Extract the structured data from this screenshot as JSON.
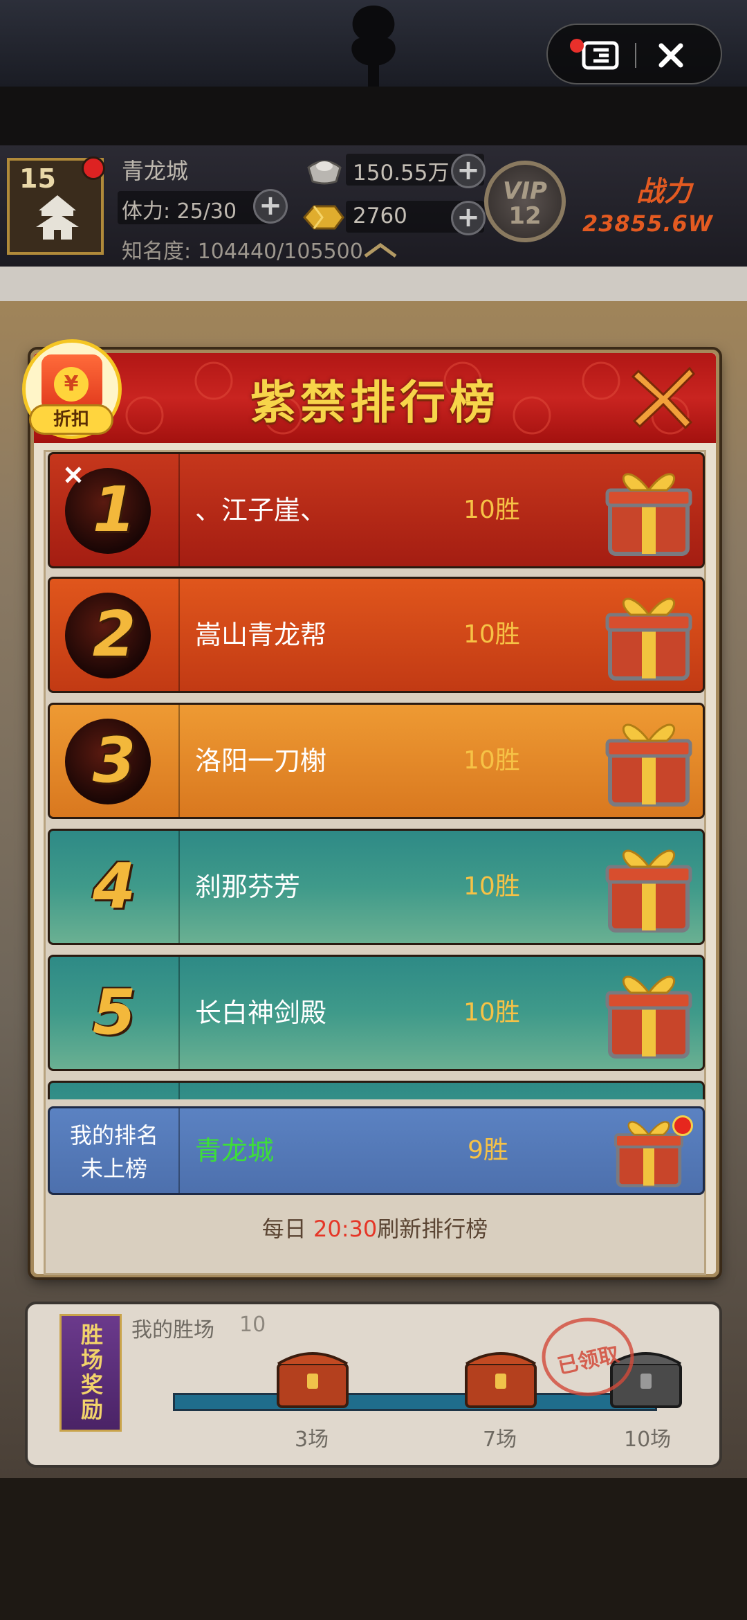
{
  "status": {
    "level": "15",
    "city_name": "青龙城",
    "stamina": "体力: 25/30",
    "fame": "知名度: 104440/105500",
    "silver": "150.55万",
    "gold": "2760",
    "vip_label": "VIP",
    "vip_level": "12",
    "power_label": "战力",
    "power_value": "23855.6W"
  },
  "discount": {
    "label": "折扣",
    "coin": "¥"
  },
  "modal": {
    "title": "紫禁排行榜",
    "rows": [
      {
        "rank": "1",
        "name": "、江子崖、",
        "wins": "10胜"
      },
      {
        "rank": "2",
        "name": "嵩山青龙帮",
        "wins": "10胜"
      },
      {
        "rank": "3",
        "name": "洛阳一刀榭",
        "wins": "10胜"
      },
      {
        "rank": "4",
        "name": "刹那芬芳",
        "wins": "10胜"
      },
      {
        "rank": "5",
        "name": "长白神剑殿",
        "wins": "10胜"
      }
    ],
    "my": {
      "label1": "我的排名",
      "label2": "未上榜",
      "name": "青龙城",
      "wins": "9胜"
    },
    "refresh": {
      "prefix": "每日 ",
      "time": "20:30",
      "suffix": "刷新排行榜"
    }
  },
  "win_panel": {
    "vlabel": "胜场奖励",
    "label": "我的胜场",
    "value": "10",
    "milestones": [
      {
        "label": "3场"
      },
      {
        "label": "7场"
      },
      {
        "label": "10场"
      }
    ],
    "claimed_stamp": "已领取"
  },
  "colors": {
    "title": "#f7d54a",
    "wins": "#f6c246",
    "my_name": "#3dde3a",
    "refresh_time": "#e53627"
  }
}
